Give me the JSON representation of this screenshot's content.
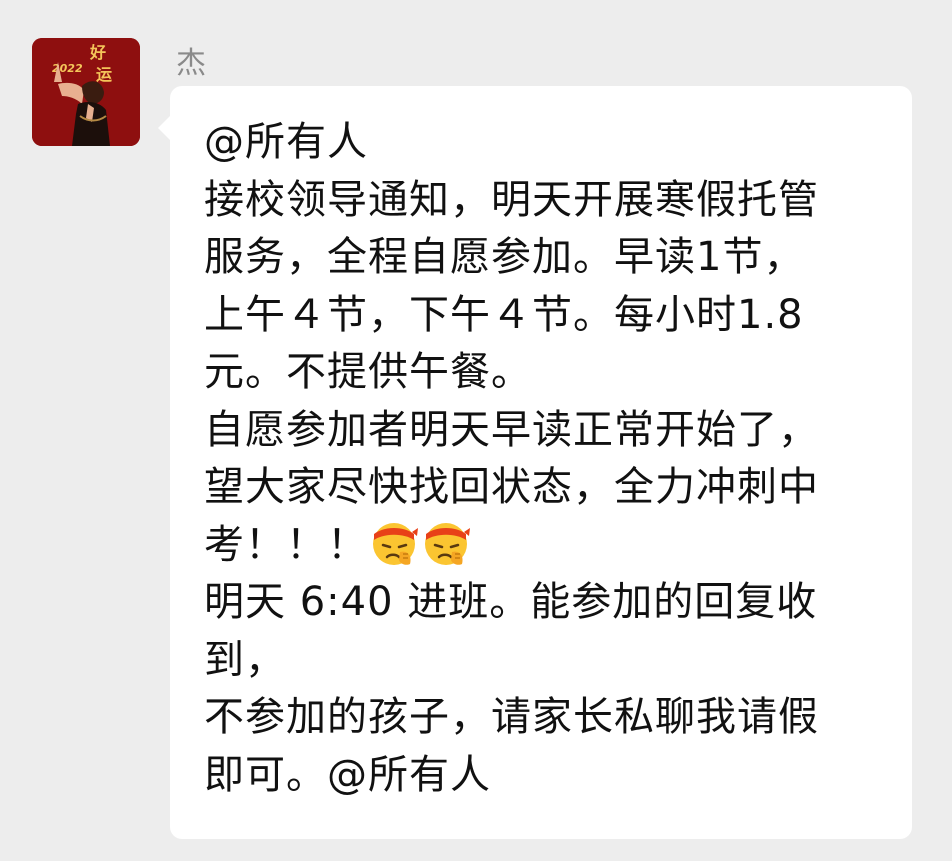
{
  "sender": {
    "name": "杰",
    "avatar_text": {
      "year": "2022",
      "caption_top": "好",
      "caption_bottom": "运"
    }
  },
  "message": {
    "lines": [
      "@所有人",
      "接校领导通知，明天开展寒假托管",
      "服务，全程自愿参加。早读1节，",
      "上午４节，下午４节。每小时1.8",
      "元。不提供午餐。",
      "自愿参加者明天早读正常开始了，",
      "望大家尽快找回状态，全力冲刺中",
      "考！！！",
      "明天 6:40 进班。能参加的回复收",
      "到，",
      "不参加的孩子，请家长私聊我请假",
      "即可。@所有人"
    ],
    "emojis": [
      "determined-headband-emoji",
      "determined-headband-emoji"
    ]
  },
  "colors": {
    "background": "#ededed",
    "bubble": "#ffffff",
    "text": "#111111",
    "name": "#8a8a8a",
    "avatar_bg": "#8e0f0f"
  }
}
